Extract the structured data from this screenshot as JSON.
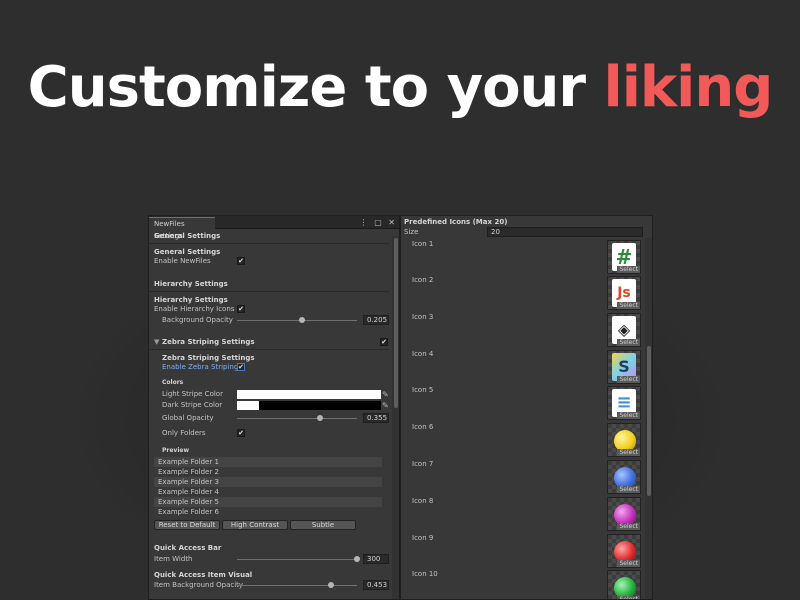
{
  "headline": {
    "main": "Customize to your",
    "accent": "liking"
  },
  "left_window": {
    "tab_title": "NewFiles Settings",
    "tab_icons": {
      "menu": "⋮",
      "maximize": "▢",
      "close": "✕"
    },
    "general": {
      "header": "General Settings",
      "subheader": "General Settings",
      "enable_label": "Enable NewFiles",
      "enable_checked": true
    },
    "hierarchy": {
      "header": "Hierarchy Settings",
      "subheader": "Hierarchy Settings",
      "enable_icons_label": "Enable Hierarchy Icons",
      "enable_icons_checked": true,
      "bg_opacity_label": "Background Opacity",
      "bg_opacity_value": "0.205",
      "bg_opacity": 0.205
    },
    "zebra": {
      "foldout_label": "Zebra Striping Settings",
      "foldout_checked": true,
      "subheader": "Zebra Striping Settings",
      "enable_label": "Enable Zebra Striping",
      "enable_checked": true,
      "colors_header": "Colors",
      "light_label": "Light Stripe Color",
      "dark_label": "Dark Stripe Color",
      "light_color": "#ffffff",
      "dark_color": "#000000",
      "global_opacity_label": "Global Opacity",
      "global_opacity_value": "0.355",
      "global_opacity": 0.355,
      "only_folders_label": "Only Folders",
      "only_folders_checked": true,
      "preview_header": "Preview",
      "preview_rows": [
        "Example Folder 1",
        "Example Folder 2",
        "Example Folder 3",
        "Example Folder 4",
        "Example Folder 5",
        "Example Folder 6"
      ],
      "buttons": {
        "reset": "Reset to Default",
        "high_contrast": "High Contrast",
        "subtle": "Subtle"
      }
    },
    "quick_access": {
      "bar_header": "Quick Access Bar",
      "item_width_label": "Item Width",
      "item_width_value": "300",
      "visual_header": "Quick Access Item Visual",
      "item_bg_opacity_label": "Item Background Opacity",
      "item_bg_opacity_value": "0.453",
      "item_bg_opacity": 0.453
    }
  },
  "right_window": {
    "title": "Predefined Icons (Max 20)",
    "size_label": "Size",
    "size_value": "20",
    "select_label": "Select",
    "icons": [
      {
        "label": "Icon 1",
        "glyph": "#",
        "kind": "hash-file-icon",
        "color": "#2e8b3e"
      },
      {
        "label": "Icon 2",
        "glyph": "Js",
        "kind": "javascript-file-icon",
        "color": "#d9482b"
      },
      {
        "label": "Icon 3",
        "glyph": "◈",
        "kind": "unity-file-icon",
        "color": "#222222"
      },
      {
        "label": "Icon 4",
        "glyph": "S",
        "kind": "shader-file-icon",
        "color": "#2a3a5a"
      },
      {
        "label": "Icon 5",
        "glyph": "≡",
        "kind": "text-file-icon",
        "color": "#3f8fd8"
      },
      {
        "label": "Icon 6",
        "kind": "yellow-ball-icon",
        "color": "#f2cf1c"
      },
      {
        "label": "Icon 7",
        "kind": "blue-ball-icon",
        "color": "#3f6fe0"
      },
      {
        "label": "Icon 8",
        "kind": "purple-ball-icon",
        "color": "#c42fb8"
      },
      {
        "label": "Icon 9",
        "kind": "red-ball-icon",
        "color": "#e02a2a"
      },
      {
        "label": "Icon 10",
        "kind": "green-ball-icon",
        "color": "#22b13a"
      }
    ]
  }
}
